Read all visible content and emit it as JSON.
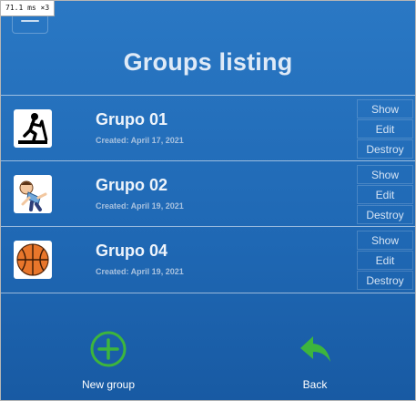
{
  "perf_overlay": "71.1 ms ×3",
  "page": {
    "title": "Groups listing"
  },
  "groups": [
    {
      "name": "Grupo 01",
      "created": "Created: April 17, 2021",
      "icon": "treadmill-icon"
    },
    {
      "name": "Grupo 02",
      "created": "Created: April 19, 2021",
      "icon": "stretching-boy-icon"
    },
    {
      "name": "Grupo 04",
      "created": "Created: April 19, 2021",
      "icon": "basketball-icon"
    }
  ],
  "row_actions": {
    "show": "Show",
    "edit": "Edit",
    "destroy": "Destroy"
  },
  "footer": {
    "new_group_label": "New group",
    "back_label": "Back"
  },
  "colors": {
    "background": "#1f68b4",
    "accent_green": "#3db53d"
  }
}
